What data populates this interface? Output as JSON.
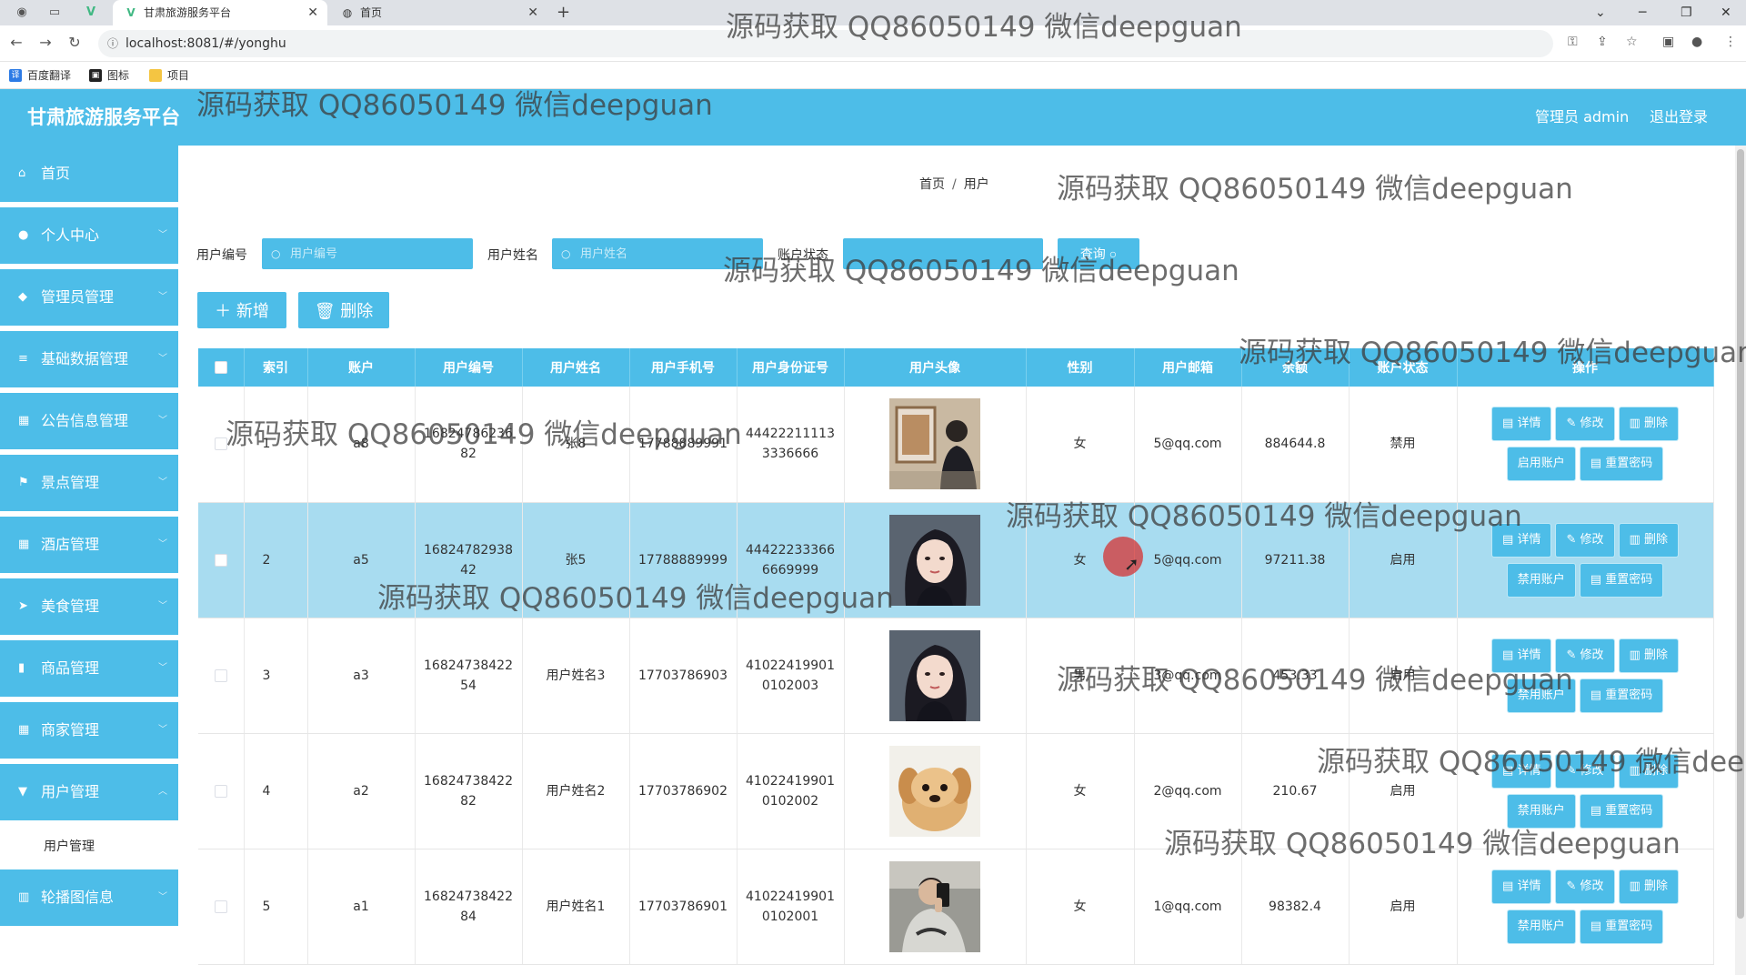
{
  "browser": {
    "tabs": [
      {
        "title": "甘肃旅游服务平台",
        "active": true
      },
      {
        "title": "首页",
        "active": false
      }
    ],
    "url": "localhost:8081/#/yonghu",
    "bookmarks": [
      "百度翻译",
      "图标",
      "项目"
    ]
  },
  "header": {
    "brand": "甘肃旅游服务平台",
    "user_label": "管理员 admin",
    "logout_label": "退出登录",
    "color": "#4dbde8"
  },
  "sidebar": {
    "items": [
      {
        "label": "首页",
        "icon": "home-icon"
      },
      {
        "label": "个人中心",
        "icon": "user-icon"
      },
      {
        "label": "管理员管理",
        "icon": "pin-icon"
      },
      {
        "label": "基础数据管理",
        "icon": "list-icon"
      },
      {
        "label": "公告信息管理",
        "icon": "grid-icon"
      },
      {
        "label": "景点管理",
        "icon": "flag-icon"
      },
      {
        "label": "酒店管理",
        "icon": "grid-icon"
      },
      {
        "label": "美食管理",
        "icon": "send-icon"
      },
      {
        "label": "商品管理",
        "icon": "chart-icon"
      },
      {
        "label": "商家管理",
        "icon": "grid-icon"
      },
      {
        "label": "用户管理",
        "icon": "filter-icon"
      },
      {
        "label": "轮播图信息",
        "icon": "bank-icon"
      }
    ],
    "subitem": "用户管理"
  },
  "breadcrumb": {
    "home": "首页",
    "current": "用户"
  },
  "search": {
    "bianhao_label": "用户编号",
    "bianhao_placeholder": "用户编号",
    "name_label": "用户姓名",
    "name_placeholder": "用户姓名",
    "status_label": "账户状态",
    "query_label": "查询"
  },
  "actions": {
    "add_label": "新增",
    "delete_label": "删除"
  },
  "table": {
    "columns": [
      "索引",
      "账户",
      "用户编号",
      "用户姓名",
      "用户手机号",
      "用户身份证号",
      "用户头像",
      "性别",
      "用户邮箱",
      "余额",
      "账户状态",
      "操作"
    ],
    "buttons": {
      "detail": "详情",
      "edit": "修改",
      "delete": "删除",
      "enable": "启用账户",
      "disable": "禁用账户",
      "reset": "重置密码"
    },
    "rows": [
      {
        "index": "1",
        "account": "a8",
        "bianhao": "1682478623682",
        "name": "张8",
        "phone": "17788889991",
        "idcard": "444222111133336666",
        "gender": "女",
        "email": "5@qq.com",
        "balance": "884644.8",
        "status": "禁用",
        "toggle": "enable",
        "avatar": "photo-man-back"
      },
      {
        "index": "2",
        "account": "a5",
        "bianhao": "1682478293842",
        "name": "张5",
        "phone": "17788889999",
        "idcard": "444222333666669999",
        "gender": "女",
        "email": "5@qq.com",
        "balance": "97211.38",
        "status": "启用",
        "toggle": "disable",
        "avatar": "photo-girl"
      },
      {
        "index": "3",
        "account": "a3",
        "bianhao": "1682473842254",
        "name": "用户姓名3",
        "phone": "17703786903",
        "idcard": "410224199010102003",
        "gender": "男",
        "email": "3@qq.com",
        "balance": "453.33",
        "status": "启用",
        "toggle": "disable",
        "avatar": "photo-girl"
      },
      {
        "index": "4",
        "account": "a2",
        "bianhao": "1682473842282",
        "name": "用户姓名2",
        "phone": "17703786902",
        "idcard": "410224199010102002",
        "gender": "女",
        "email": "2@qq.com",
        "balance": "210.67",
        "status": "启用",
        "toggle": "disable",
        "avatar": "photo-puppy"
      },
      {
        "index": "5",
        "account": "a1",
        "bianhao": "1682473842284",
        "name": "用户姓名1",
        "phone": "17703786901",
        "idcard": "410224199010102001",
        "gender": "女",
        "email": "1@qq.com",
        "balance": "98382.4",
        "status": "启用",
        "toggle": "disable",
        "avatar": "photo-man-selfie"
      }
    ]
  },
  "watermark": "源码获取 QQ86050149 微信deepguan"
}
